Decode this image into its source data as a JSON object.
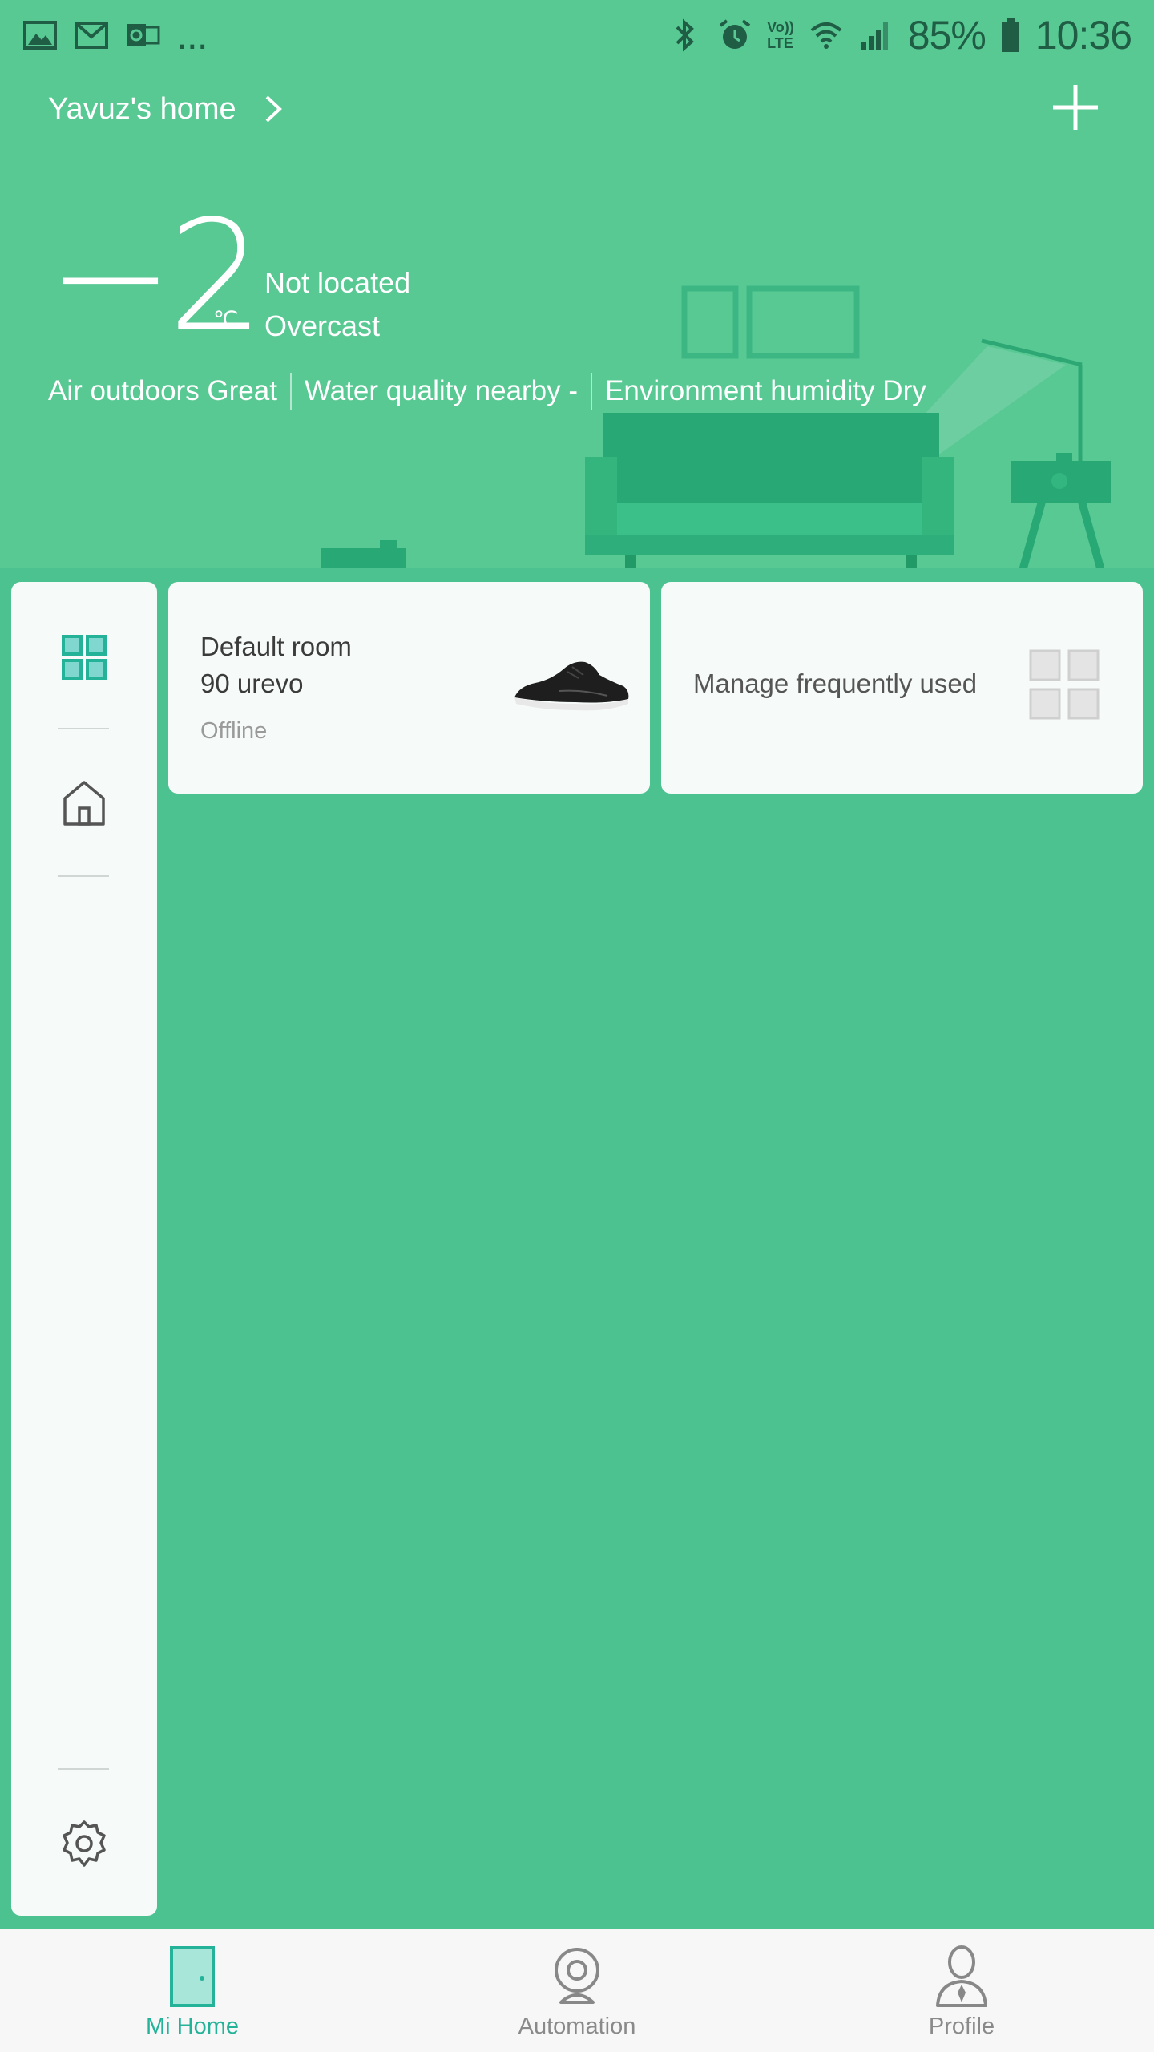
{
  "status_bar": {
    "left_icons": [
      "gallery-icon",
      "gmail-icon",
      "outlook-icon",
      "more-notifications-icon"
    ],
    "more_text": "...",
    "right_icons": [
      "bluetooth-icon",
      "alarm-icon",
      "volte-icon",
      "wifi-icon",
      "signal-icon",
      "battery-icon"
    ],
    "volte_line1": "Vo))",
    "volte_line2": "LTE",
    "battery": "85%",
    "time": "10:36"
  },
  "header": {
    "home_title": "Yavuz's home",
    "add_icon": "plus-icon"
  },
  "weather": {
    "temperature": "−2",
    "unit": "℃",
    "location": "Not located",
    "condition": "Overcast"
  },
  "environment": [
    "Air outdoors Great",
    "Water quality nearby -",
    "Environment humidity Dry"
  ],
  "sidebar": {
    "items": [
      {
        "icon": "grid-icon",
        "active": true
      },
      {
        "icon": "house-icon",
        "active": false
      },
      {
        "icon": "gear-icon",
        "active": false
      }
    ]
  },
  "cards": {
    "room": {
      "room_name": "Default room",
      "device_name": "90 urevo",
      "status": "Offline"
    },
    "manage": {
      "label": "Manage frequently used"
    }
  },
  "bottom_nav": {
    "items": [
      {
        "label": "Mi Home",
        "icon": "door-icon",
        "active": true
      },
      {
        "label": "Automation",
        "icon": "camera-icon",
        "active": false
      },
      {
        "label": "Profile",
        "icon": "person-icon",
        "active": false
      }
    ]
  },
  "colors": {
    "header_bg": "#59c994",
    "page_bg": "#4cc290",
    "card_bg": "#f6fbf9",
    "accent": "#24b398",
    "status_icons": "#1f5d45"
  }
}
